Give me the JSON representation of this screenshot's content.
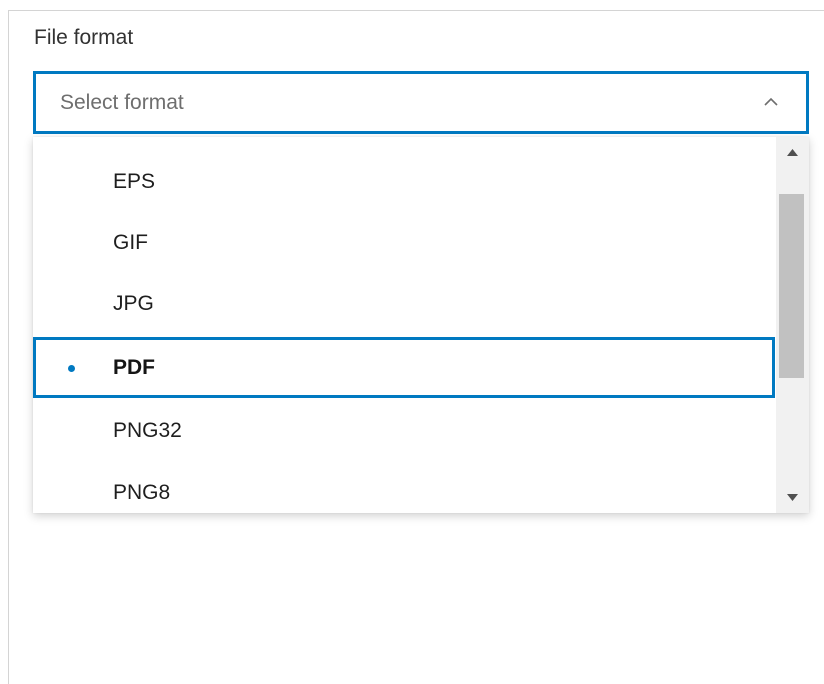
{
  "field": {
    "label": "File format",
    "placeholder": "Select format",
    "expanded": true
  },
  "dropdown": {
    "options": [
      {
        "label": "EPS",
        "selected": false
      },
      {
        "label": "GIF",
        "selected": false
      },
      {
        "label": "JPG",
        "selected": false
      },
      {
        "label": "PDF",
        "selected": true
      },
      {
        "label": "PNG32",
        "selected": false
      },
      {
        "label": "PNG8",
        "selected": false
      }
    ],
    "selected_value": "PDF"
  },
  "icons": {
    "chevron": "chevron-up-icon",
    "scroll_up": "triangle-up-icon",
    "scroll_down": "triangle-down-icon",
    "selected_marker": "bullet-dot-icon"
  },
  "colors": {
    "accent": "#0079c1",
    "text": "#1e1e1e",
    "placeholder": "#6e6e6e",
    "scroll_track": "#f1f1f1",
    "scroll_thumb": "#c1c1c1"
  }
}
